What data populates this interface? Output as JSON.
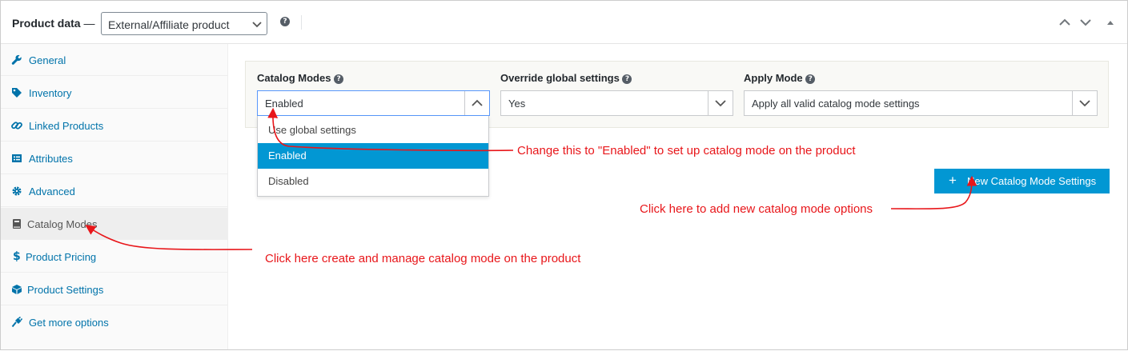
{
  "header": {
    "title": "Product data",
    "dash": " —",
    "product_type": "External/Affiliate product",
    "help": "?"
  },
  "sidebar": {
    "items": [
      {
        "label": "General",
        "icon": "wrench-icon"
      },
      {
        "label": "Inventory",
        "icon": "tag-icon"
      },
      {
        "label": "Linked Products",
        "icon": "link-icon"
      },
      {
        "label": "Attributes",
        "icon": "list-icon"
      },
      {
        "label": "Advanced",
        "icon": "gear-icon"
      },
      {
        "label": "Catalog Modes",
        "icon": "book-icon"
      },
      {
        "label": "Product Pricing",
        "icon": "dollar-icon"
      },
      {
        "label": "Product Settings",
        "icon": "cube-icon"
      },
      {
        "label": "Get more options",
        "icon": "plug-icon"
      }
    ],
    "active_index": 5
  },
  "fields": {
    "catalog_modes": {
      "label": "Catalog Modes",
      "value": "Enabled"
    },
    "override": {
      "label": "Override global settings",
      "value": "Yes"
    },
    "apply_mode": {
      "label": "Apply Mode",
      "value": "Apply all valid catalog mode settings"
    }
  },
  "dropdown": {
    "options": [
      "Use global settings",
      "Enabled",
      "Disabled"
    ],
    "selected_index": 1
  },
  "button": {
    "plus": "+",
    "label": "New Catalog Mode Settings"
  },
  "annotations": {
    "enabled_note": "Change this to \"Enabled\" to set up catalog mode on the product",
    "button_note": "Click here to add new catalog mode options",
    "sidebar_note": "Click here create and manage catalog mode on the product"
  },
  "colors": {
    "accent": "#0297d3",
    "link": "#0073aa",
    "annotation": "#e8161a"
  }
}
